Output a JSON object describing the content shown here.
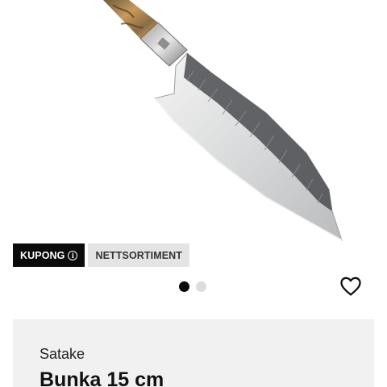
{
  "product_image": {
    "alt": "Satake Bunka 15 cm kniv"
  },
  "badges": {
    "coupon_label": "KUPONG",
    "coupon_info_icon": "info-icon",
    "online_label": "NETTSORTIMENT"
  },
  "carousel": {
    "total": 2,
    "active": 1
  },
  "favorite": {
    "icon": "heart-outline-icon"
  },
  "product": {
    "brand": "Satake",
    "title": "Bunka 15 cm"
  },
  "colors": {
    "badge_dark": "#0b0b0b",
    "badge_light": "#e4e4e4",
    "card_bg": "#f1f1f1"
  }
}
